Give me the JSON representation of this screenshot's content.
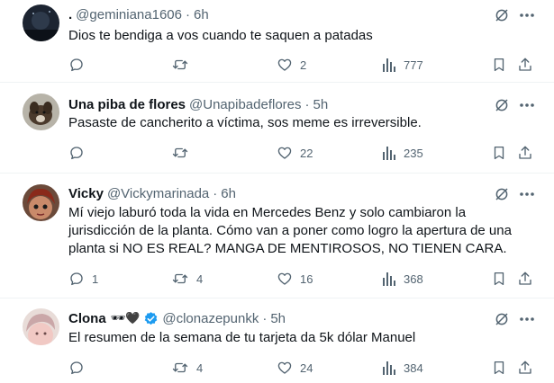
{
  "tweets": [
    {
      "name": ".",
      "handle": "@geminiana1606",
      "sep": "·",
      "time": "6h",
      "text_lines": [
        "Dios te bendiga a vos cuando te saquen a patadas"
      ],
      "replies": "",
      "retweets": "",
      "likes": "2",
      "views": "777",
      "avatar": "dark-night-image"
    },
    {
      "name": "Una piba de flores",
      "handle": "@Unapibadeflores",
      "sep": "·",
      "time": "5h",
      "text_lines": [
        "Pasaste de cancherito a víctima, sos meme es irreversible."
      ],
      "replies": "",
      "retweets": "",
      "likes": "22",
      "views": "235",
      "avatar": "dog-photo"
    },
    {
      "name": "Vicky",
      "handle": "@Vickymarinada",
      "sep": "·",
      "time": "6h",
      "text_lines": [
        "Mí viejo laburó toda la vida en Mercedes Benz y solo cambiaron la",
        "jurisdicción de la planta. Cómo van a poner como logro la apertura de una",
        "planta si NO ES REAL? MANGA DE MENTIROSOS, NO TIENEN CARA."
      ],
      "replies": "1",
      "retweets": "4",
      "likes": "16",
      "views": "368",
      "avatar": "doll-photo"
    },
    {
      "name": "Clona",
      "name_emoji": "🕶🖤",
      "handle": "@clonazepunkk",
      "sep": "·",
      "time": "5h",
      "text_lines": [
        "El resumen de la semana de tu tarjeta da 5k dólar Manuel"
      ],
      "replies": "",
      "retweets": "4",
      "likes": "24",
      "views": "384",
      "avatar": "profile-photo",
      "verified": true
    }
  ],
  "colors": {
    "text": "#0f1419",
    "secondary": "#536471",
    "divider": "#eff3f4",
    "verified": "#1d9bf0"
  }
}
